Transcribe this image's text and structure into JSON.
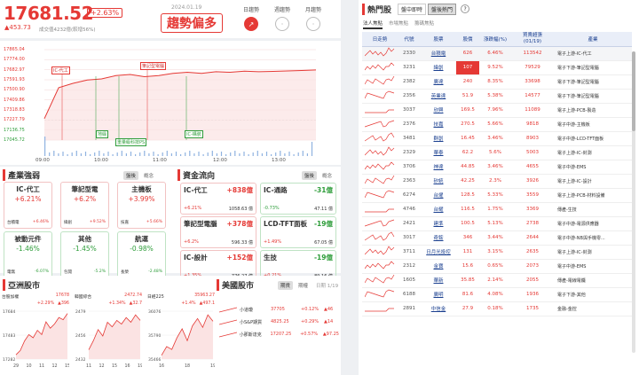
{
  "index": {
    "price": "17681.52",
    "change_pct": "+2.63%",
    "change_pts": "▲453.73",
    "volume": "成交值4232億(較增56%)",
    "date": "2024.01.19",
    "trend": "趨勢偏多",
    "trend_buttons": [
      {
        "label": "日趨勢",
        "active": true
      },
      {
        "label": "週趨勢",
        "active": false
      },
      {
        "label": "月趨勢",
        "active": false
      }
    ]
  },
  "chart_data": {
    "type": "line",
    "y_ticks": [
      "17865.04",
      "17774.00",
      "17682.97",
      "17591.93",
      "17500.90",
      "17409.86",
      "17318.83",
      "17227.79",
      "17136.75",
      "17045.72"
    ],
    "x_ticks": [
      "09:00",
      "10:00",
      "11:00",
      "12:00",
      "13:00"
    ],
    "ylim": [
      17045.72,
      17865.04
    ],
    "x": [
      "09:00",
      "09:15",
      "09:30",
      "09:45",
      "10:00",
      "10:15",
      "10:30",
      "10:45",
      "11:00",
      "11:15",
      "11:30",
      "11:45",
      "12:00",
      "12:15",
      "12:30",
      "12:45",
      "13:00",
      "13:15",
      "13:25",
      "13:30"
    ],
    "values": [
      17240,
      17520,
      17560,
      17590,
      17600,
      17630,
      17640,
      17620,
      17630,
      17650,
      17660,
      17650,
      17665,
      17660,
      17670,
      17665,
      17668,
      17672,
      17676,
      17681.52
    ],
    "annotations": [
      {
        "label": "IC-代工",
        "color": "red"
      },
      {
        "label": "筆記型電腦",
        "color": "red"
      },
      {
        "label": "地緣",
        "color": "green"
      },
      {
        "label": "重量級科技PS",
        "color": "green"
      },
      {
        "label": "IC-構裝",
        "color": "green"
      }
    ]
  },
  "industry": {
    "title": "產業強弱",
    "tabs": [
      "盤後",
      "概念"
    ],
    "boxes": [
      {
        "name": "IC-代工",
        "pct": "+6.21%",
        "color": "red",
        "subs": [
          {
            "n": "台積電",
            "v": "+6.46%",
            "c": "red"
          }
        ]
      },
      {
        "name": "筆記型電",
        "pct": "+6.2%",
        "color": "red",
        "subs": [
          {
            "n": "緯創",
            "v": "+9.52%",
            "c": "red"
          }
        ]
      },
      {
        "name": "主機板",
        "pct": "+3.99%",
        "color": "red",
        "subs": [
          {
            "n": "技嘉",
            "v": "+5.66%",
            "c": "red"
          }
        ]
      },
      {
        "name": "被動元件",
        "pct": "-1.46%",
        "color": "green",
        "subs": [
          {
            "n": "電無",
            "v": "-6.07%",
            "c": "green"
          }
        ]
      },
      {
        "name": "其他",
        "pct": "-1.45%",
        "color": "green",
        "subs": [
          {
            "n": "包開",
            "v": "-5.2%",
            "c": "green"
          }
        ]
      },
      {
        "name": "航運",
        "pct": "-0.98%",
        "color": "green",
        "subs": [
          {
            "n": "長榮",
            "v": "-2.48%",
            "c": "green"
          }
        ]
      }
    ]
  },
  "funds": {
    "title": "資金流向",
    "tabs": [
      "盤後",
      "概念"
    ],
    "boxes": [
      {
        "name": "IC-代工",
        "amt": "+838億",
        "pct": "+6.21%",
        "val": "1058.63 億",
        "color": "red"
      },
      {
        "name": "IC-通路",
        "amt": "-31億",
        "pct": "-0.73%",
        "val": "47.11 億",
        "color": "green"
      },
      {
        "name": "筆記型電腦",
        "amt": "+378億",
        "pct": "+6.2%",
        "val": "596.33 億",
        "color": "red"
      },
      {
        "name": "LCD-TFT面板",
        "amt": "-19億",
        "pct": "+1.49%",
        "val": "67.05 億",
        "color": "green"
      },
      {
        "name": "IC-設計",
        "amt": "+152億",
        "pct": "+1.35%",
        "val": "776.27 億",
        "color": "red"
      },
      {
        "name": "生技",
        "amt": "-19億",
        "pct": "+0.21%",
        "val": "89.16 億",
        "color": "green"
      }
    ]
  },
  "asia": {
    "title": "亞洲股市",
    "charts": [
      {
        "name": "台股加權",
        "price": "17678",
        "chg": "+2.29%",
        "pts": "▲396",
        "y": [
          "17684",
          "17483",
          "17282"
        ],
        "x": [
          "29",
          "10",
          "11",
          "12",
          "15"
        ]
      },
      {
        "name": "韓國綜合",
        "price": "2472.74",
        "chg": "+1.34%",
        "pts": "▲32.7",
        "y": [
          "2479",
          "2456",
          "2432"
        ],
        "x": [
          "11",
          "12",
          "15",
          "16",
          "19"
        ]
      },
      {
        "name": "日經225",
        "price": "35963.27",
        "chg": "+1.4%",
        "pts": "▲497.1",
        "y": [
          "36076",
          "35790",
          "35466"
        ],
        "x": [
          "16",
          "18",
          "19"
        ]
      }
    ]
  },
  "us": {
    "title": "美國股市",
    "tabs": [
      "期貨",
      "期權"
    ],
    "date": "日期 1/19",
    "rows": [
      {
        "name": "小道瓊",
        "price": "37705",
        "pct": "+0.12%",
        "pts": "▲46"
      },
      {
        "name": "小S&P期貨",
        "price": "4825.25",
        "pct": "+0.29%",
        "pts": "▲14"
      },
      {
        "name": "小那斯達克",
        "price": "17207.25",
        "pct": "+0.57%",
        "pts": "▲97.25"
      }
    ]
  },
  "hot": {
    "title": "熱門股",
    "top_tabs": [
      {
        "label": "盤中即時",
        "active": false
      },
      {
        "label": "盤後熱門",
        "active": true
      }
    ],
    "help_icon": "?",
    "sub_tabs": [
      "法人焦點",
      "市場焦點",
      "籌碼焦點"
    ],
    "headers": [
      "日走勢",
      "代號",
      "股票",
      "股價",
      "漲跌幅(%)",
      "買賣超張\n(01/19)",
      "產業"
    ],
    "rows": [
      {
        "code": "2330",
        "name": "台積電",
        "price": "626",
        "pct": "6.46%",
        "net": "113542",
        "ind": "電子上游-IC-代工",
        "hot": false
      },
      {
        "code": "3231",
        "name": "緯創",
        "price": "107",
        "pct": "9.52%",
        "net": "79529",
        "ind": "電子下游-筆記型電腦",
        "hot": true
      },
      {
        "code": "2382",
        "name": "廣達",
        "price": "240",
        "pct": "8.35%",
        "net": "33698",
        "ind": "電子下游-筆記型電腦",
        "hot": false
      },
      {
        "code": "2356",
        "name": "英業達",
        "price": "51.9",
        "pct": "5.38%",
        "net": "14577",
        "ind": "電子下游-筆記型電腦",
        "hot": false
      },
      {
        "code": "3037",
        "name": "欣興",
        "price": "169.5",
        "pct": "7.96%",
        "net": "11089",
        "ind": "電子上游-PCB-製造",
        "hot": false
      },
      {
        "code": "2376",
        "name": "技嘉",
        "price": "270.5",
        "pct": "5.66%",
        "net": "9818",
        "ind": "電子中游-主機板",
        "hot": false
      },
      {
        "code": "3481",
        "name": "群創",
        "price": "16.45",
        "pct": "3.46%",
        "net": "8903",
        "ind": "電子中游-LCD-TFT面板",
        "hot": false
      },
      {
        "code": "2329",
        "name": "華泰",
        "price": "62.2",
        "pct": "5.6%",
        "net": "5003",
        "ind": "電子上游-IC-封測",
        "hot": false
      },
      {
        "code": "3706",
        "name": "神達",
        "price": "44.85",
        "pct": "3.46%",
        "net": "4655",
        "ind": "電子中游-EMS",
        "hot": false
      },
      {
        "code": "2363",
        "name": "矽統",
        "price": "42.25",
        "pct": "2.3%",
        "net": "3926",
        "ind": "電子上游-IC-設計",
        "hot": false
      },
      {
        "code": "6274",
        "name": "台燿",
        "price": "128.5",
        "pct": "5.33%",
        "net": "3559",
        "ind": "電子上游-PCB-材料設備",
        "hot": false
      },
      {
        "code": "4746",
        "name": "台耀",
        "price": "116.5",
        "pct": "1.75%",
        "net": "3369",
        "ind": "傳產-生技",
        "hot": false
      },
      {
        "code": "2421",
        "name": "建準",
        "price": "100.5",
        "pct": "5.13%",
        "net": "2738",
        "ind": "電子中游-電源供應器",
        "hot": false
      },
      {
        "code": "3017",
        "name": "奇鋐",
        "price": "346",
        "pct": "3.44%",
        "net": "2644",
        "ind": "電子中游-NB與手機零...",
        "hot": false
      },
      {
        "code": "3711",
        "name": "日月光投控",
        "price": "131",
        "pct": "3.15%",
        "net": "2635",
        "ind": "電子上游-IC-封測",
        "hot": false
      },
      {
        "code": "2312",
        "name": "金寶",
        "price": "15.6",
        "pct": "0.65%",
        "net": "2073",
        "ind": "電子中游-EMS",
        "hot": false
      },
      {
        "code": "1605",
        "name": "華新",
        "price": "35.85",
        "pct": "2.14%",
        "net": "2055",
        "ind": "傳產-電線電纜",
        "hot": false
      },
      {
        "code": "6188",
        "name": "廣明",
        "price": "81.6",
        "pct": "4.08%",
        "net": "1936",
        "ind": "電子下游-其他",
        "hot": false
      },
      {
        "code": "2891",
        "name": "中信金",
        "price": "27.9",
        "pct": "0.18%",
        "net": "1735",
        "ind": "金融-金控",
        "hot": false
      }
    ]
  }
}
